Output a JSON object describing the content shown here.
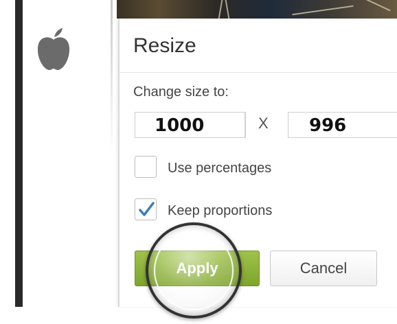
{
  "dialog": {
    "title": "Resize",
    "size_label": "Change size to:",
    "width_value": "1000",
    "separator": "X",
    "height_value": "996",
    "use_percentages_label": "Use percentages",
    "use_percentages_checked": false,
    "keep_proportions_label": "Keep proportions",
    "keep_proportions_checked": true,
    "apply_label": "Apply",
    "cancel_label": "Cancel"
  },
  "icons": {
    "sidebar_icon": "apple-icon",
    "checkbox_check": "checkmark-icon"
  },
  "colors": {
    "apply_green": "#8db43a",
    "check_blue": "#3a7fc1",
    "title_text": "#333333"
  }
}
